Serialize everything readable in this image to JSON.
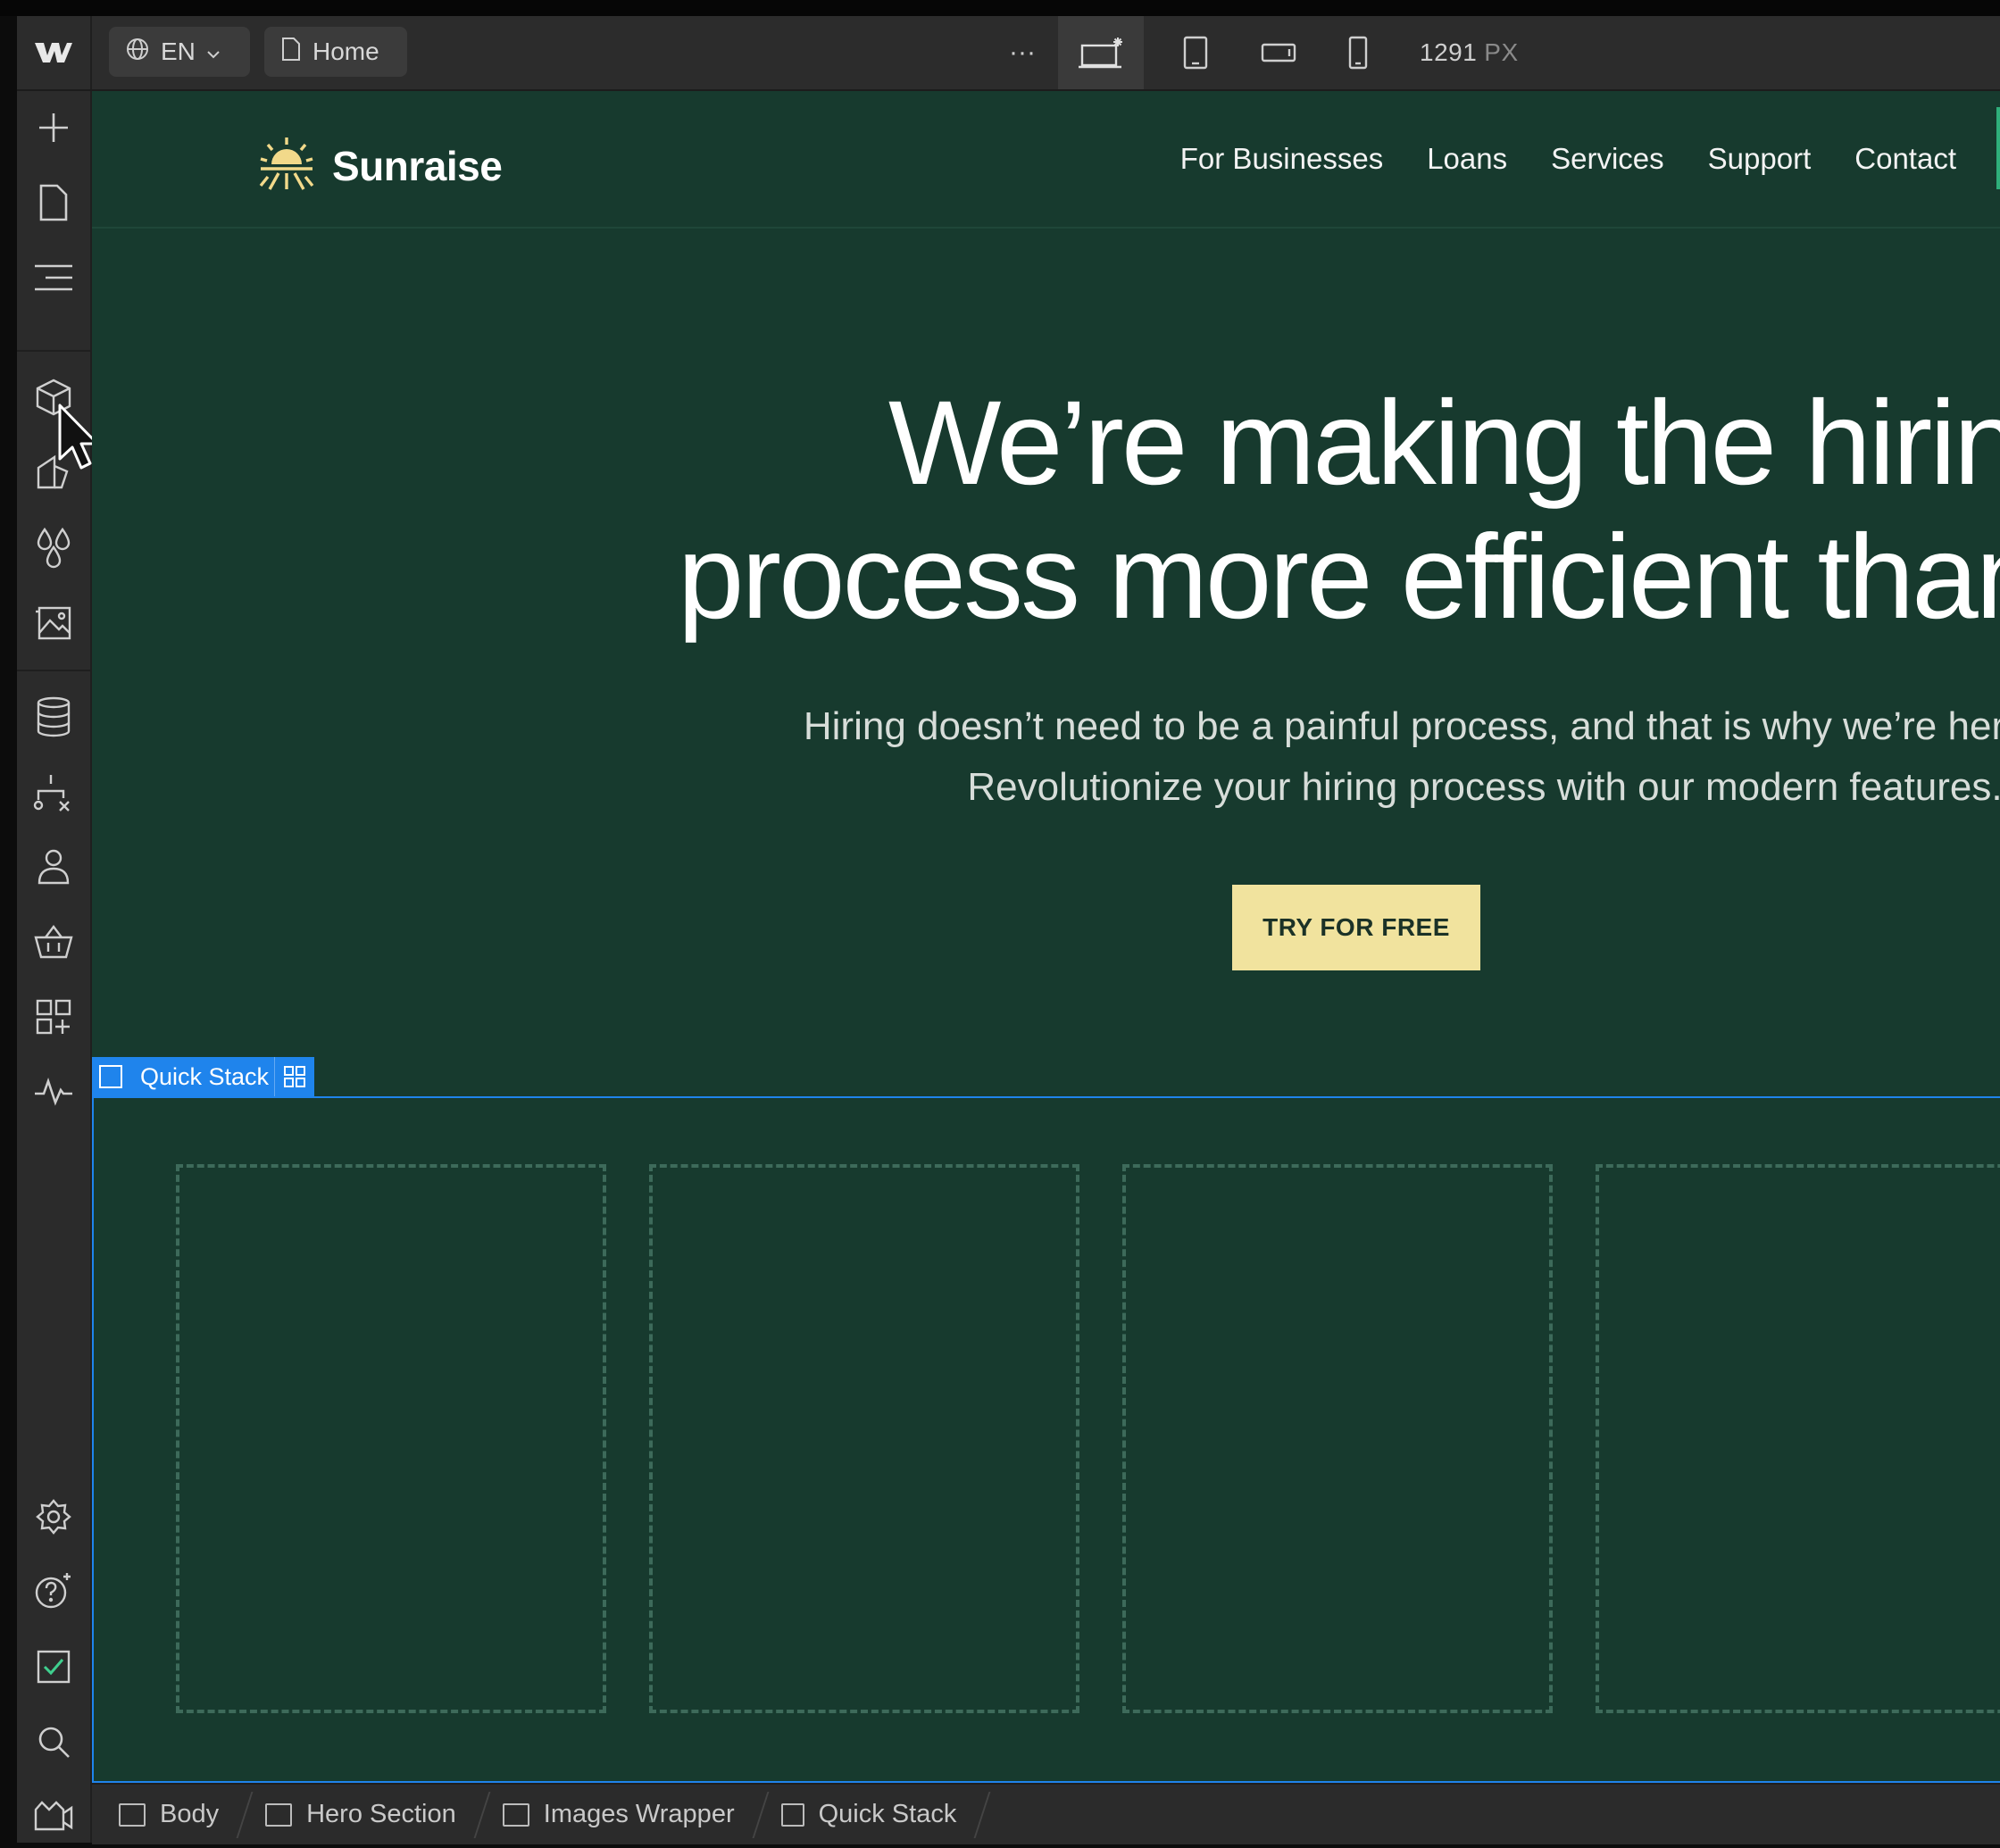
{
  "topbar": {
    "language": "EN",
    "page": "Home",
    "more": "···",
    "viewport_width": "1291",
    "viewport_unit": "PX"
  },
  "site": {
    "brand": "Sunraise",
    "nav": [
      "For Businesses",
      "Loans",
      "Services",
      "Support",
      "Contact"
    ],
    "hero_title_line1": "We’re making the hiring",
    "hero_title_line2": "process more efficient than ever",
    "hero_sub_line1": "Hiring doesn’t need to be a painful process, and that is why we’re here to help.",
    "hero_sub_line2": "Revolutionize your hiring process with our modern features.",
    "cta": "TRY FOR FREE"
  },
  "selection": {
    "label": "Quick Stack"
  },
  "breadcrumb": [
    "Body",
    "Hero Section",
    "Images Wrapper",
    "Quick Stack"
  ],
  "colors": {
    "canvas_bg": "#173a2e",
    "cta_bg": "#f1e39e",
    "selection_blue": "#1f84ec",
    "brand_sun": "#f2d98a"
  }
}
